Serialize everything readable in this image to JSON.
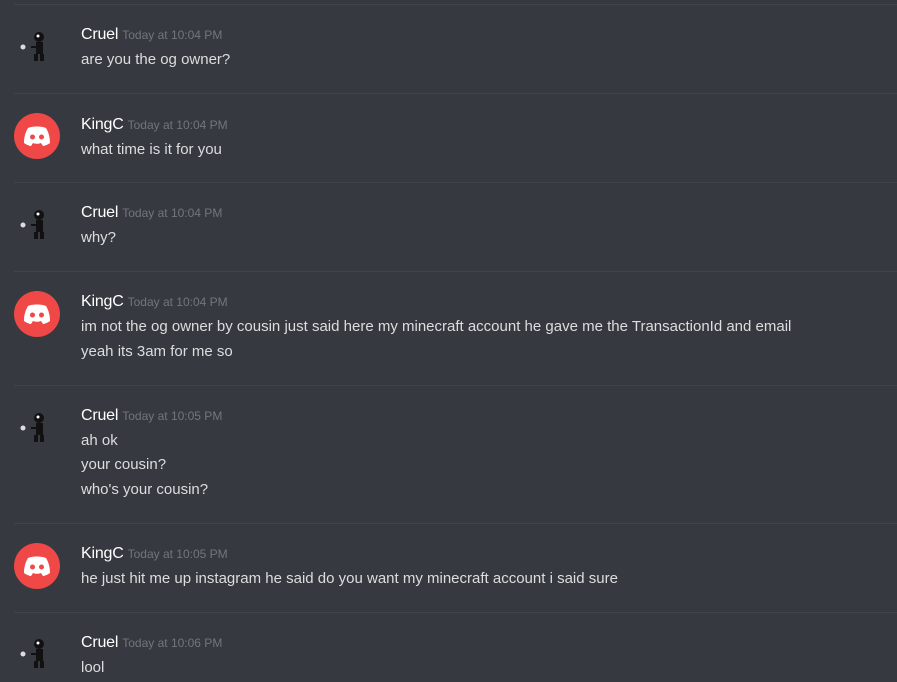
{
  "messages": [
    {
      "author": "Cruel",
      "timestamp": "Today at 10:04 PM",
      "avatar": "figure-avatar-icon",
      "lines": [
        "are you the og owner?"
      ]
    },
    {
      "author": "KingC",
      "timestamp": "Today at 10:04 PM",
      "avatar": "discord-logo-icon",
      "lines": [
        "what time is it for you"
      ]
    },
    {
      "author": "Cruel",
      "timestamp": "Today at 10:04 PM",
      "avatar": "figure-avatar-icon",
      "lines": [
        "why?"
      ]
    },
    {
      "author": "KingC",
      "timestamp": "Today at 10:04 PM",
      "avatar": "discord-logo-icon",
      "lines": [
        "im not the og owner by cousin just said here my minecraft account he gave me the TransactionId and email",
        "yeah its 3am for me so"
      ]
    },
    {
      "author": "Cruel",
      "timestamp": "Today at 10:05 PM",
      "avatar": "figure-avatar-icon",
      "lines": [
        "ah ok",
        "your cousin?",
        "who's your cousin?"
      ]
    },
    {
      "author": "KingC",
      "timestamp": "Today at 10:05 PM",
      "avatar": "discord-logo-icon",
      "lines": [
        "he just hit me up instagram he said do you want my minecraft account i said sure"
      ]
    },
    {
      "author": "Cruel",
      "timestamp": "Today at 10:06 PM",
      "avatar": "figure-avatar-icon",
      "lines": [
        "lool"
      ]
    }
  ],
  "colors": {
    "background": "#36393f",
    "divider": "#40434a",
    "username": "#ffffff",
    "timestamp": "#72767d",
    "message_text": "#dcddde",
    "discord_avatar": "#f04747"
  }
}
